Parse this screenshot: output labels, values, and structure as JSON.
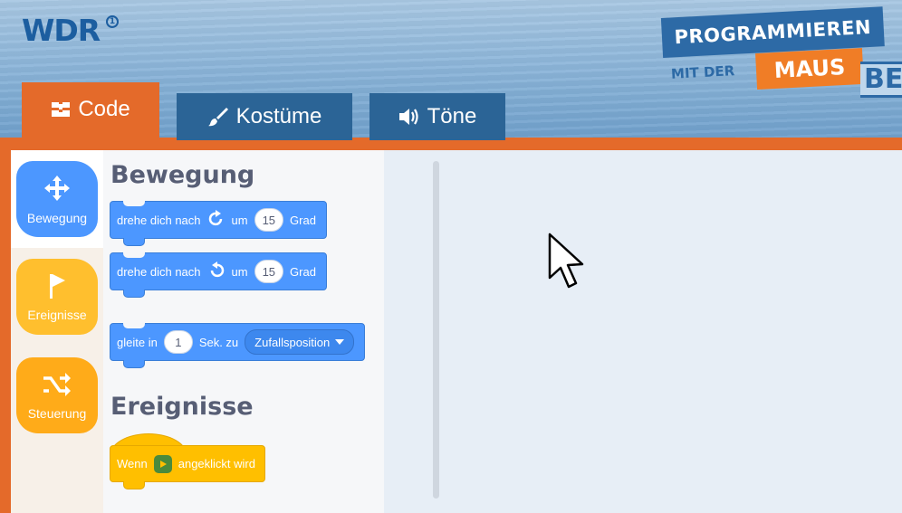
{
  "header": {
    "logo": "WDR",
    "logo_mark": "1",
    "brand": {
      "line1": "PROGRAMMIEREN",
      "line2_prefix": "MIT DER",
      "line2_highlight": "MAUS",
      "partial_word": "BE"
    }
  },
  "tabs": [
    {
      "label": "Code",
      "icon": "code-blocks-icon",
      "active": true
    },
    {
      "label": "Kostüme",
      "icon": "brush-icon",
      "active": false
    },
    {
      "label": "Töne",
      "icon": "speaker-icon",
      "active": false
    }
  ],
  "categories": [
    {
      "label": "Bewegung",
      "icon": "move-arrows-icon",
      "color": "#4c97ff",
      "selected": true
    },
    {
      "label": "Ereignisse",
      "icon": "flag-icon",
      "color": "#ffbf2e",
      "selected": false
    },
    {
      "label": "Steuerung",
      "icon": "shuffle-icon",
      "color": "#ffab19",
      "selected": false
    }
  ],
  "palette": {
    "sections": [
      {
        "title": "Bewegung",
        "blocks": [
          {
            "text_before": "drehe dich nach",
            "icon": "rotate-right-icon",
            "text_mid": "um",
            "value": "15",
            "text_after": "Grad"
          },
          {
            "text_before": "drehe dich nach",
            "icon": "rotate-left-icon",
            "text_mid": "um",
            "value": "15",
            "text_after": "Grad"
          },
          {
            "text_before": "gleite in",
            "value": "1",
            "text_mid": "Sek. zu",
            "dropdown": "Zufallsposition"
          }
        ]
      },
      {
        "title": "Ereignisse",
        "blocks": [
          {
            "text_before": "Wenn",
            "icon": "green-flag-icon",
            "text_after": "angeklickt wird"
          }
        ]
      }
    ]
  },
  "colors": {
    "accent_orange": "#e46a2a",
    "tab_blue": "#2b6496",
    "motion_blue": "#4c97ff",
    "events_yellow": "#ffbf00"
  }
}
